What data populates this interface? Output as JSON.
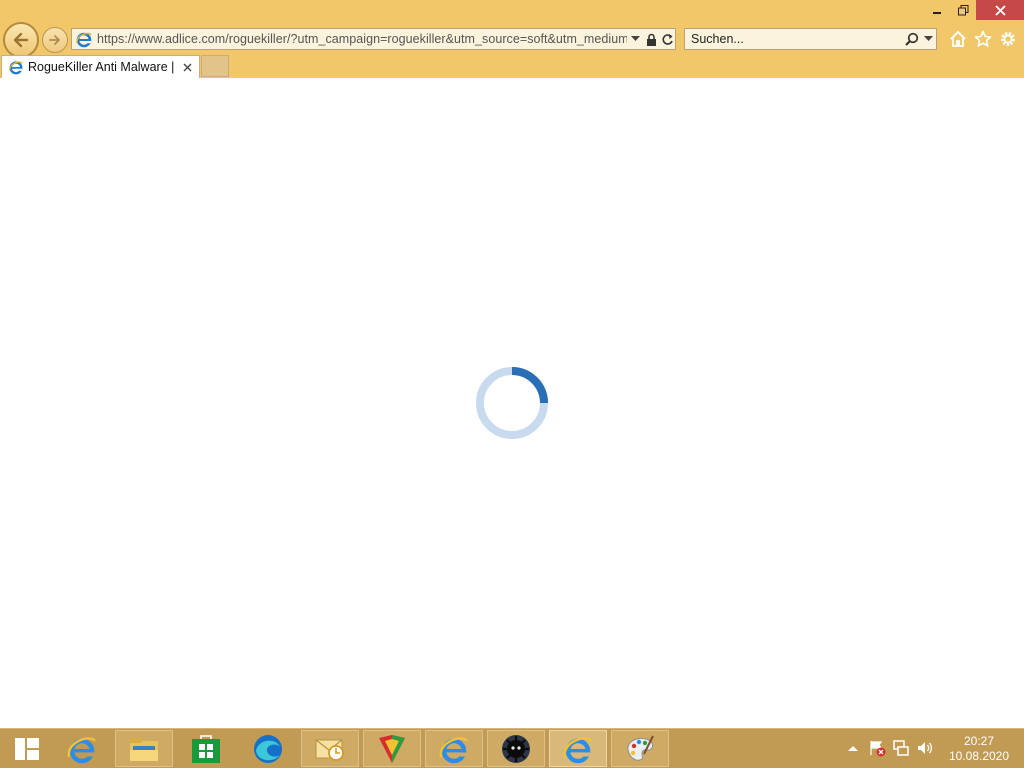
{
  "browser": {
    "address": {
      "url": "https://www.adlice.com/roguekiller/?utm_campaign=roguekiller&utm_source=soft&utm_medium"
    },
    "search": {
      "placeholder": "Suchen..."
    },
    "tabs": [
      {
        "title": "RogueKiller Anti Malware | ..."
      }
    ]
  },
  "content": {
    "state": "loading"
  },
  "taskbar": {
    "items": [
      {
        "name": "internet-explorer",
        "icon": "ie-icon"
      },
      {
        "name": "file-explorer",
        "icon": "folder-icon"
      },
      {
        "name": "store",
        "icon": "store-icon"
      },
      {
        "name": "edge",
        "icon": "edge-icon"
      },
      {
        "name": "outlook",
        "icon": "outlook-icon"
      },
      {
        "name": "shield-app",
        "icon": "shield-icon"
      },
      {
        "name": "internet-explorer-2",
        "icon": "ie-icon"
      },
      {
        "name": "roguekiller",
        "icon": "roguekiller-icon"
      },
      {
        "name": "internet-explorer-active",
        "icon": "ie-icon"
      },
      {
        "name": "paint",
        "icon": "paint-icon"
      }
    ],
    "clock": {
      "time": "20:27",
      "date": "10.08.2020"
    }
  },
  "colors": {
    "chrome": "#f2c76a",
    "taskbar": "#c19a54",
    "close": "#c74848",
    "spinner": "#2a6fb6",
    "spinner_track": "#c8daee"
  }
}
